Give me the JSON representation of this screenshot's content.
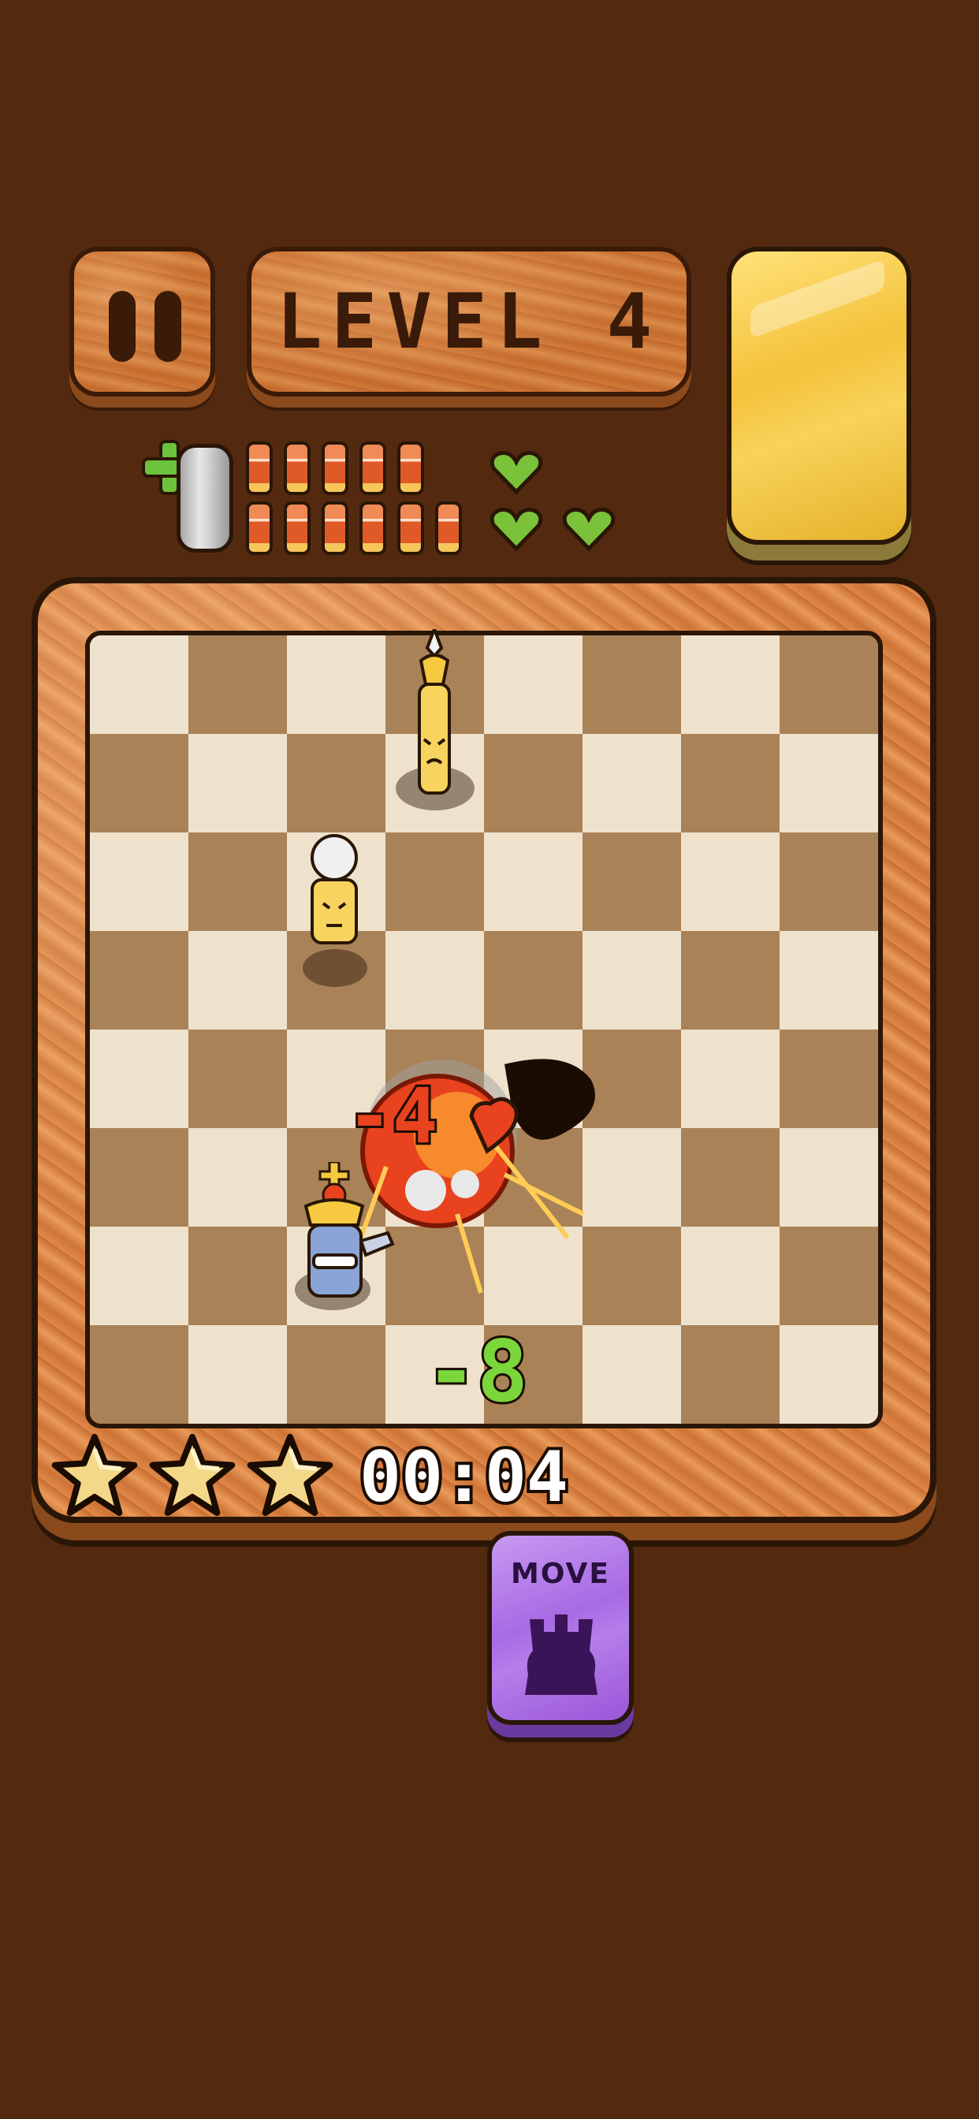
{
  "header": {
    "level_title": "LEVEL 4"
  },
  "ammo": {
    "shells_top_row": 5,
    "shells_bottom_row": 6,
    "hearts": 3
  },
  "effects": {
    "damage_red": "-4",
    "damage_green": "-8"
  },
  "footer": {
    "stars_earned": 3,
    "timer": "00:04",
    "move_card_label": "MOVE",
    "move_card_icon": "rook-icon"
  },
  "colors": {
    "background": "#532a10",
    "gold_card": "#f4c23a",
    "move_card": "#a86ae4",
    "heart": "#7ac23a",
    "damage_red": "#e8421e",
    "damage_green": "#7ad63a"
  }
}
